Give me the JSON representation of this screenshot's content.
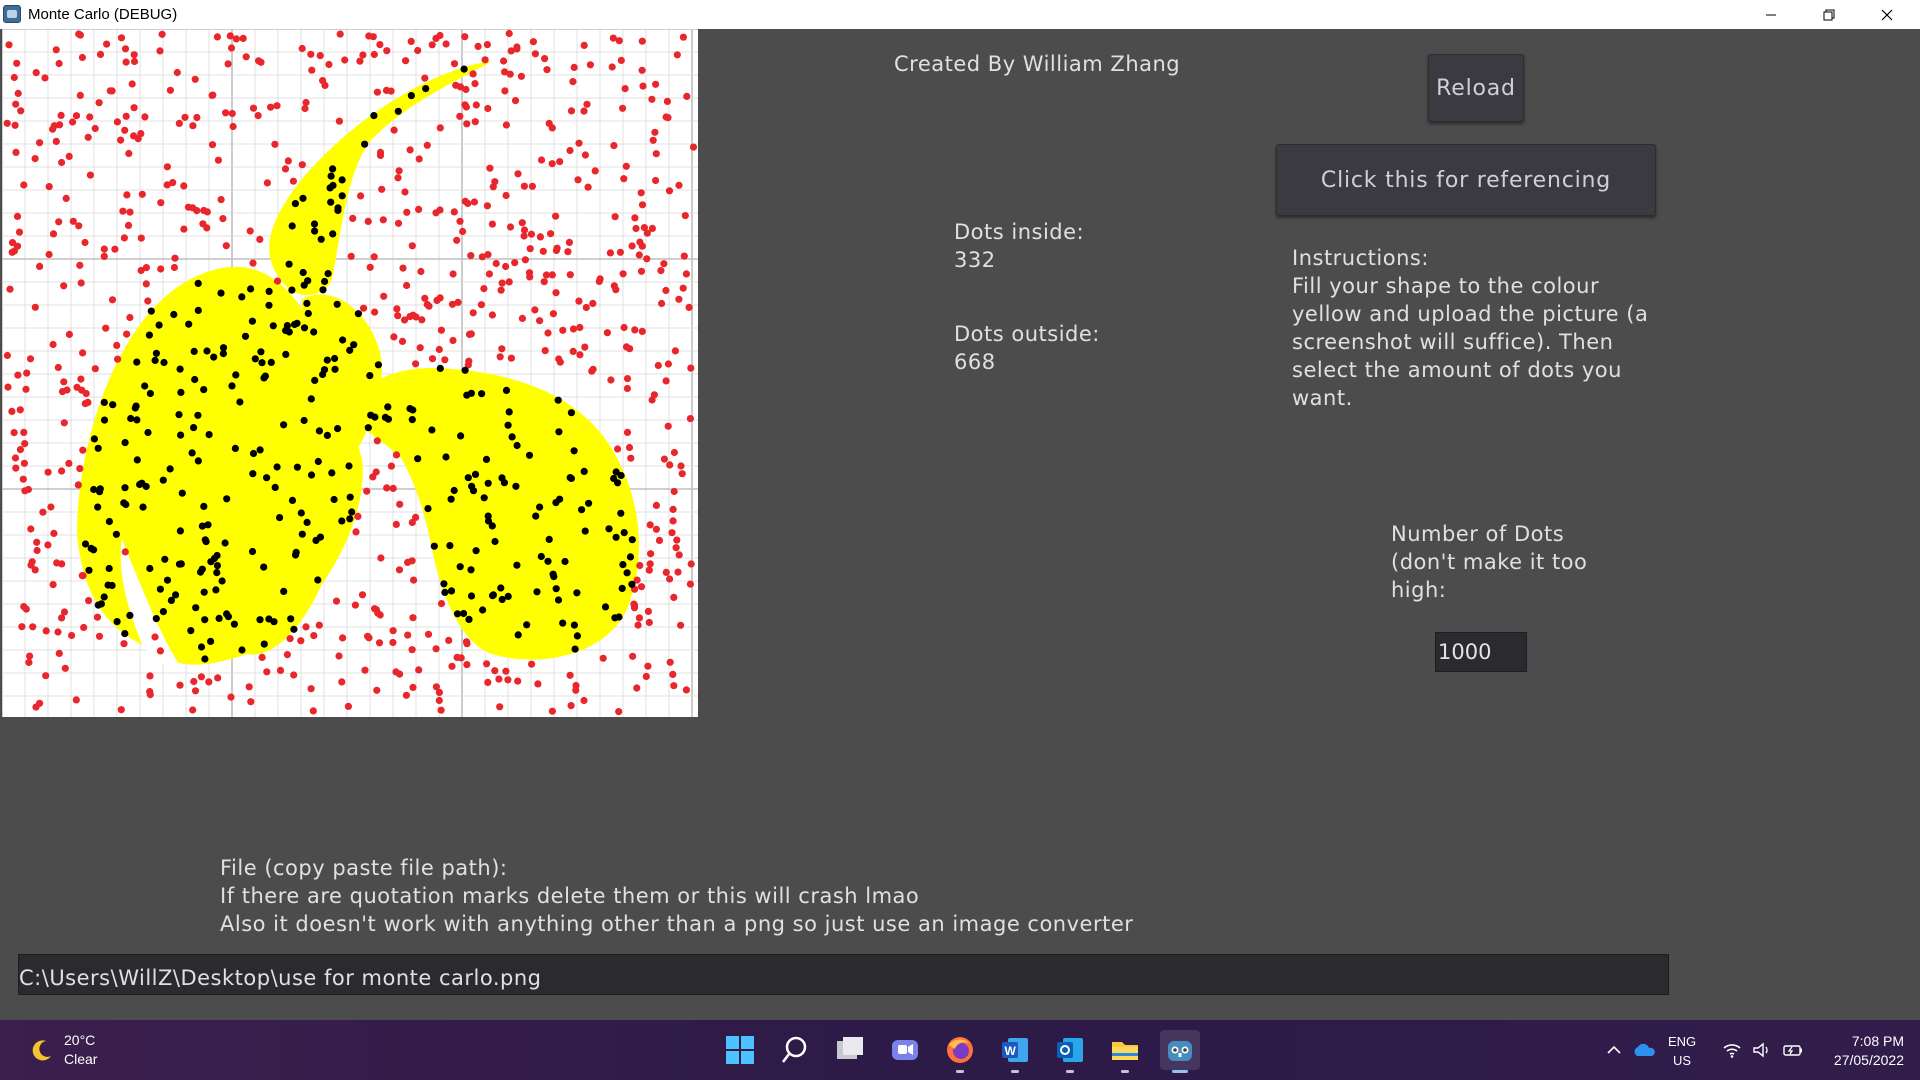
{
  "window": {
    "title": "Monte Carlo (DEBUG)",
    "controls": [
      "minimize",
      "restore",
      "close"
    ]
  },
  "header": {
    "credit": "Created By William Zhang"
  },
  "buttons": {
    "reload": "Reload",
    "reference": "Click this for referencing"
  },
  "stats": {
    "inside_label": "Dots inside:",
    "inside_value": "332",
    "outside_label": "Dots outside:",
    "outside_value": "668"
  },
  "instructions": {
    "heading": "Instructions:",
    "lines": [
      "Fill your shape to the colour",
      "yellow and upload the picture (a",
      "screenshot will suffice). Then",
      "select the amount of dots you",
      "want."
    ]
  },
  "dots_field": {
    "label_lines": [
      "Number of Dots",
      "(don't make it too",
      "high:"
    ],
    "value": "1000"
  },
  "file_field": {
    "label_lines": [
      "File (copy paste file path):",
      "If there are quotation marks delete them or this will crash lmao",
      "Also it doesn't work with anything other than a png so just use an image converter"
    ],
    "value": "C:\\Users\\WillZ\\Desktop\\use for monte carlo.png"
  },
  "canvas": {
    "shape_color": "#ffff00",
    "inside_dot_color": "#000000",
    "outside_dot_color": "#e8262b",
    "grid_color": "#d9d9d9"
  },
  "taskbar": {
    "weather_temp": "20°C",
    "weather_condition": "Clear",
    "pinned": [
      "start-icon",
      "search-icon",
      "task-view-icon",
      "chat-icon",
      "firefox-icon",
      "word-icon",
      "outlook-icon",
      "file-explorer-icon",
      "godot-icon"
    ],
    "language_line1": "ENG",
    "language_line2": "US",
    "time": "7:08 PM",
    "date": "27/05/2022"
  }
}
